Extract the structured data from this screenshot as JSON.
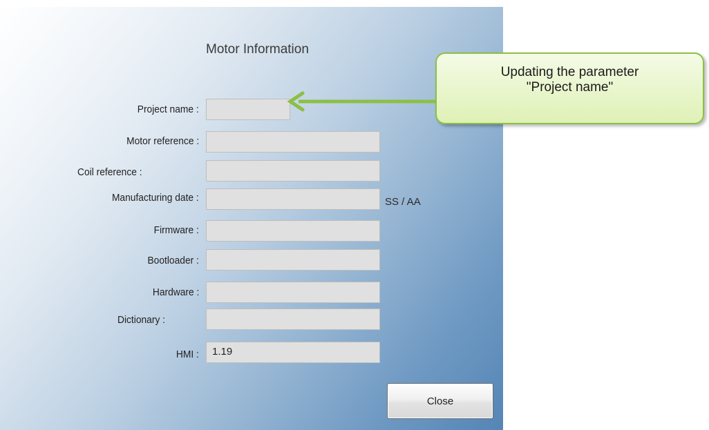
{
  "dialog": {
    "title": "Motor Information",
    "fields": [
      {
        "key": "project_name",
        "label": "Project name :",
        "value": ""
      },
      {
        "key": "motor_reference",
        "label": "Motor reference :",
        "value": ""
      },
      {
        "key": "coil_reference",
        "label": "Coil reference :",
        "value": ""
      },
      {
        "key": "manufacturing_date",
        "label": "Manufacturing date :",
        "value": "",
        "unit": "SS / AA"
      },
      {
        "key": "firmware",
        "label": "Firmware :",
        "value": ""
      },
      {
        "key": "bootloader",
        "label": "Bootloader :",
        "value": ""
      },
      {
        "key": "hardware",
        "label": "Hardware :",
        "value": ""
      },
      {
        "key": "dictionary",
        "label": "Dictionary :",
        "value": ""
      },
      {
        "key": "hmi",
        "label": "HMI :",
        "value": "1.19"
      }
    ],
    "close_label": "Close"
  },
  "callout": {
    "line1": "Updating the parameter",
    "line2": "\"Project name\"",
    "arrow_color": "#8cbf46"
  }
}
